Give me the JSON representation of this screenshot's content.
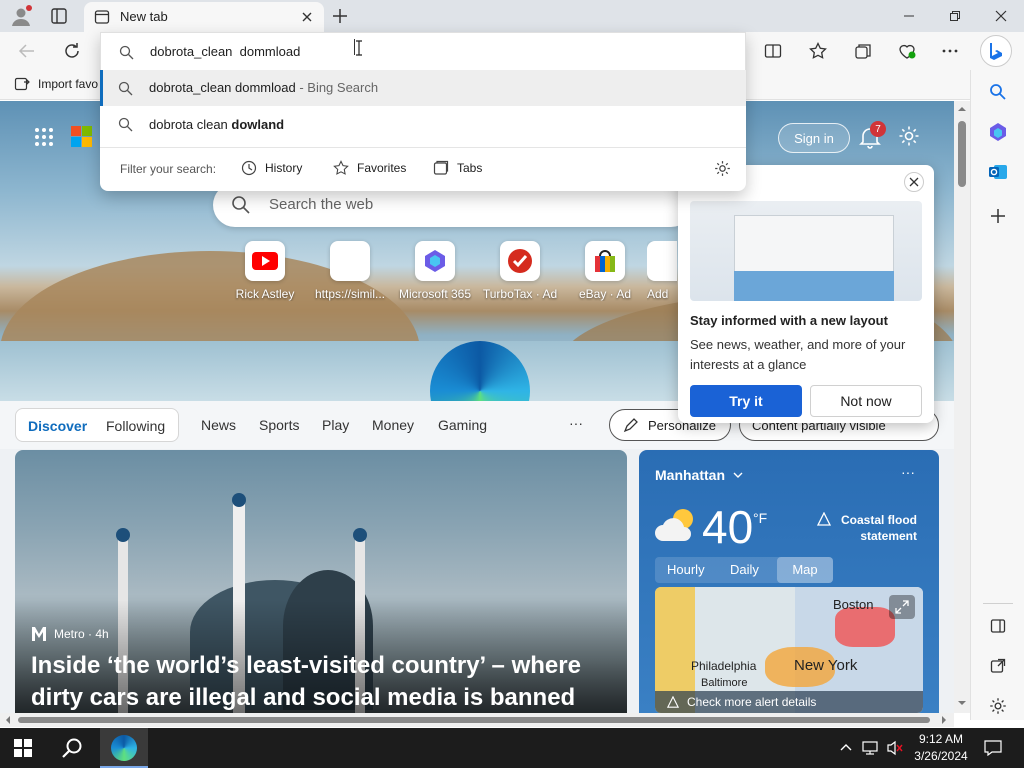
{
  "browser": {
    "tab_title": "New tab",
    "address_text": "dobrota_clean  dommload",
    "favorites_import": "Import favo"
  },
  "suggestions": [
    {
      "text": "dobrota_clean dommload",
      "suffix": " - Bing Search"
    },
    {
      "text": "dobrota clean ",
      "bold": "dowland"
    }
  ],
  "filter": {
    "label": "Filter your search:",
    "history": "History",
    "favorites": "Favorites",
    "tabs": "Tabs"
  },
  "header": {
    "sign_in": "Sign in",
    "notif_count": "7",
    "search_placeholder": "Search the web"
  },
  "quick_links": [
    {
      "label": "Rick Astley",
      "icon": "youtube-icon"
    },
    {
      "label": "https://simil...",
      "icon": "blank-icon"
    },
    {
      "label": "Microsoft 365",
      "icon": "m365-icon"
    },
    {
      "label": "TurboTax · Ad",
      "icon": "turbotax-icon"
    },
    {
      "label": "eBay · Ad",
      "icon": "ebay-icon"
    },
    {
      "label": "Add",
      "icon": "add-icon"
    }
  ],
  "popup": {
    "title": "Stay informed with a new layout",
    "body": "See news, weather, and more of your interests at a glance",
    "try": "Try it",
    "not_now": "Not now"
  },
  "feed_nav": {
    "discover": "Discover",
    "following": "Following",
    "items": [
      "News",
      "Sports",
      "Play",
      "Money",
      "Gaming"
    ],
    "more": "···",
    "personalize": "Personalize",
    "content_visibility": "Content partially visible"
  },
  "article": {
    "source": "Metro · 4h",
    "headline": "Inside ‘the world’s least-visited country’ – where dirty cars are illegal and social media is banned"
  },
  "weather": {
    "location": "Manhattan",
    "temp": "40",
    "unit": "°F",
    "alert": "Coastal flood statement",
    "tabs": [
      "Hourly",
      "Daily",
      "Map"
    ],
    "map_labels": {
      "boston": "Boston",
      "new_york": "New York",
      "philadelphia": "Philadelphia",
      "baltimore": "Baltimore"
    },
    "alert_link": "Check more alert details"
  },
  "taskbar": {
    "time": "9:12 AM",
    "date": "3/26/2024"
  },
  "colors": {
    "accent": "#0f6cbd",
    "popup_button": "#1a62d6"
  }
}
